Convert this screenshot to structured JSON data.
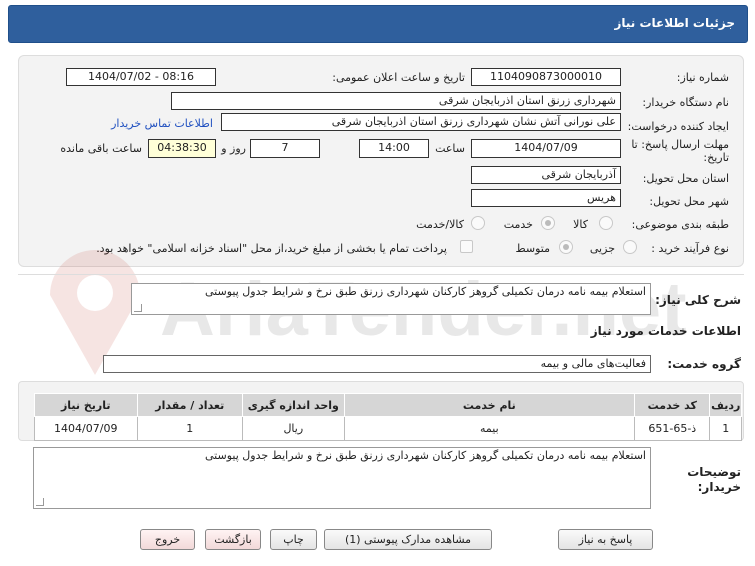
{
  "header": {
    "title": "جزئیات اطلاعات نیاز"
  },
  "form": {
    "need_number_label": "شماره نیاز:",
    "need_number": "1104090873000010",
    "announce_label": "تاریخ و ساعت اعلان عمومی:",
    "announce_value": "1404/07/02 - 08:16",
    "buyer_org_label": "نام دستگاه خریدار:",
    "buyer_org": "شهرداری زرنق استان اذربایجان شرقی",
    "creator_label": "ایجاد کننده درخواست:",
    "creator": "علی نورانی آتش نشان شهرداری زرنق استان اذربایجان شرقی",
    "contact_link": "اطلاعات تماس خریدار",
    "deadline_label_1": "مهلت ارسال پاسخ: تا",
    "deadline_label_2": "تاریخ:",
    "deadline_date": "1404/07/09",
    "time_label": "ساعت",
    "deadline_time": "14:00",
    "days_value": "7",
    "days_label": "روز و",
    "remaining_time": "04:38:30",
    "remaining_label": "ساعت باقی مانده",
    "province_label": "استان محل تحویل:",
    "province": "آذربایجان شرقی",
    "city_label": "شهر محل تحویل:",
    "city": "هریس",
    "category_label": "طبقه بندی موضوعی:",
    "category_options": [
      "کالا",
      "خدمت",
      "کالا/خدمت"
    ],
    "category_selected": "خدمت",
    "process_label": "نوع فرآیند خرید :",
    "process_options": [
      "جزیی",
      "متوسط"
    ],
    "process_selected": "متوسط",
    "payment_note": "پرداخت تمام یا بخشی از مبلغ خرید،از محل \"اسناد خزانه اسلامی\" خواهد بود."
  },
  "summary": {
    "label": "شرح کلی نیاز:",
    "text": "استعلام بیمه نامه درمان تکمیلی گروهز کارکنان شهرداری زرنق طبق نرخ و شرایط جدول پیوستی"
  },
  "services": {
    "section_title": "اطلاعات خدمات مورد نیاز",
    "group_label": "گروه خدمت:",
    "group_value": "فعالیت‌های مالی و بیمه",
    "columns": [
      "ردیف",
      "کد خدمت",
      "نام خدمت",
      "واحد اندازه گیری",
      "تعداد / مقدار",
      "تاریخ نیاز"
    ],
    "rows": [
      [
        "1",
        "ذ-65-651",
        "بیمه",
        "ریال",
        "1",
        "1404/07/09"
      ]
    ]
  },
  "buyer_notes": {
    "label_1": "توضیحات",
    "label_2": "خریدار:",
    "text": "استعلام بیمه نامه درمان تکمیلی گروهز کارکنان شهرداری زرنق طبق نرخ و شرایط جدول پیوستی"
  },
  "watermark": "AriaTender.net",
  "buttons": {
    "reply": "پاسخ به نیاز",
    "attachments": "مشاهده مدارک پیوستی (1)",
    "print": "چاپ",
    "back": "بازگشت",
    "exit": "خروج"
  },
  "colors": {
    "header_bg": "#2f5f9d",
    "link": "#2050c0",
    "highlight": "#ffffd8"
  }
}
